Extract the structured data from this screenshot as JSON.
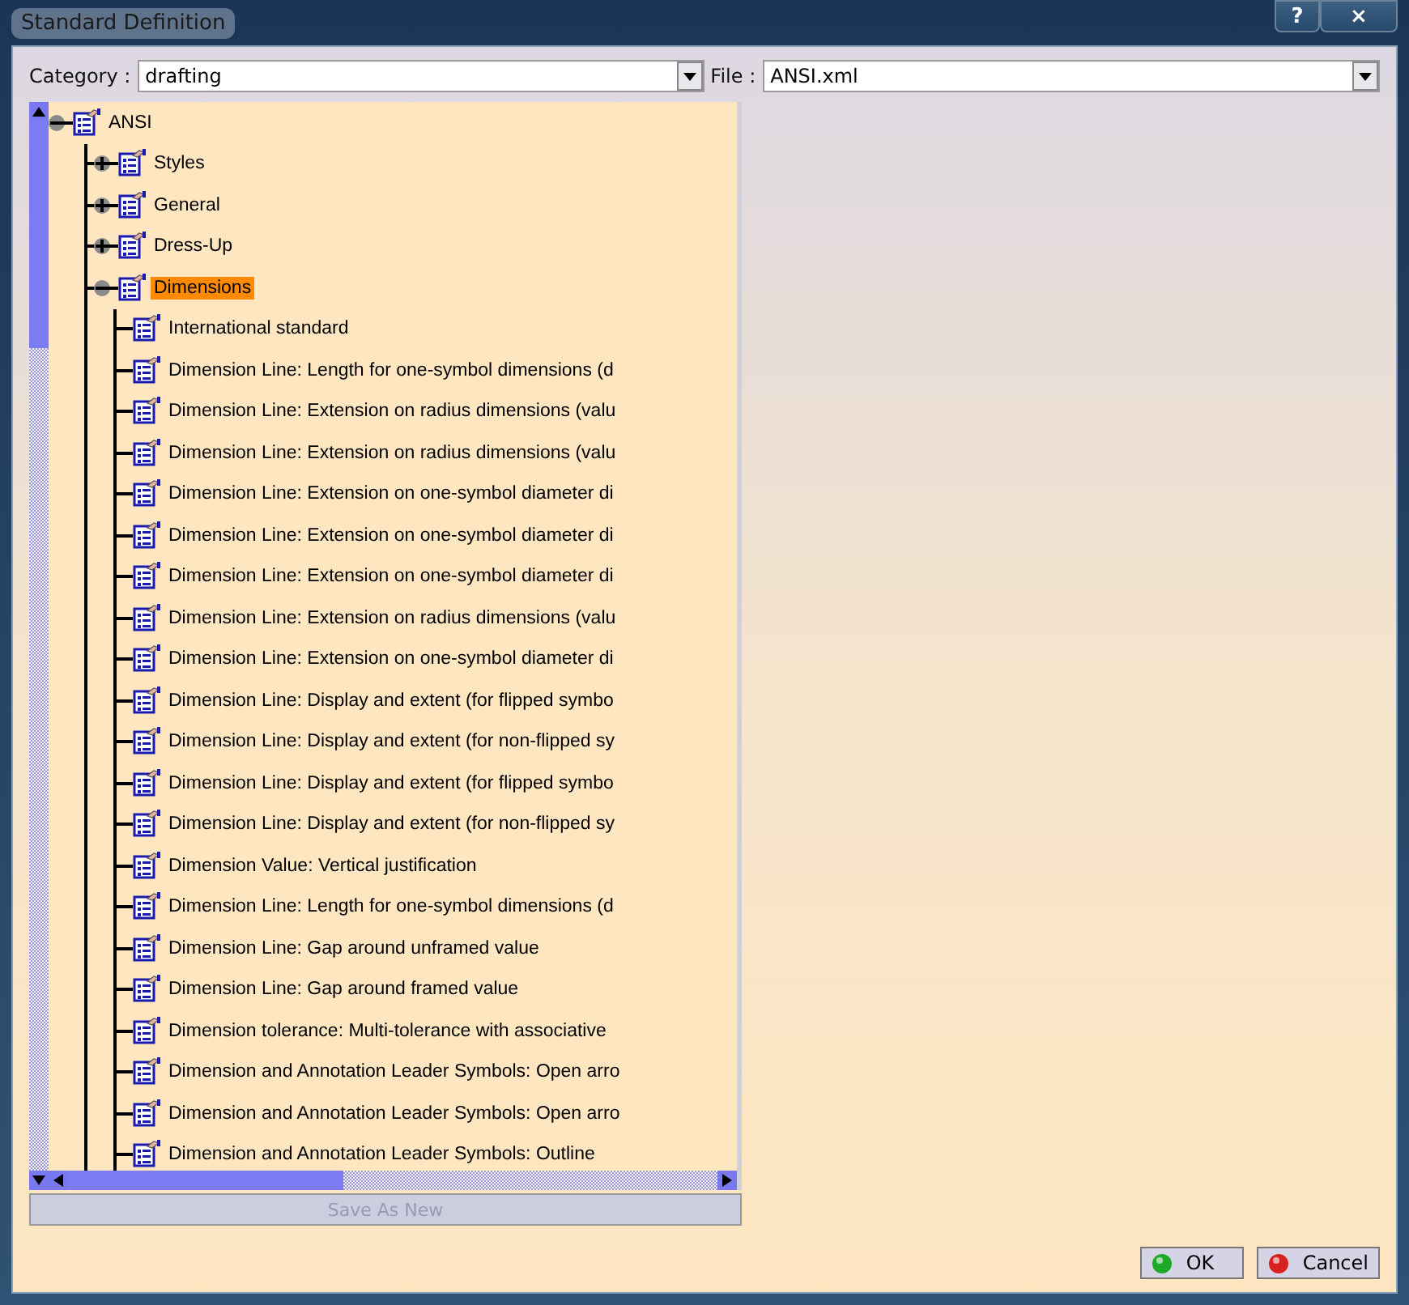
{
  "window": {
    "title": "Standard Definition",
    "buttons": [
      "?",
      "×"
    ]
  },
  "category": {
    "label": "Category :",
    "value": "drafting"
  },
  "file": {
    "label": "File :",
    "value": "ANSI.xml"
  },
  "tree": [
    {
      "label": "ANSI",
      "expanded": true,
      "selected": false,
      "children": [
        {
          "label": "Styles",
          "expanded": false,
          "selected": false
        },
        {
          "label": "General",
          "expanded": false,
          "selected": false
        },
        {
          "label": "Dress-Up",
          "expanded": false,
          "selected": false
        },
        {
          "label": "Dimensions",
          "expanded": true,
          "selected": true,
          "children": [
            {
              "label": "International standard",
              "selected": false
            },
            {
              "label": "Dimension Line: Length for one-symbol dimensions (d",
              "selected": false
            },
            {
              "label": "Dimension Line: Extension on radius dimensions (valu",
              "selected": false
            },
            {
              "label": "Dimension Line: Extension on radius dimensions (valu",
              "selected": false
            },
            {
              "label": "Dimension Line: Extension on one-symbol diameter di",
              "selected": false
            },
            {
              "label": "Dimension Line: Extension on one-symbol diameter di",
              "selected": false
            },
            {
              "label": "Dimension Line: Extension on one-symbol diameter di",
              "selected": false
            },
            {
              "label": "Dimension Line: Extension on radius dimensions (valu",
              "selected": false
            },
            {
              "label": "Dimension Line: Extension on one-symbol diameter di",
              "selected": false
            },
            {
              "label": "Dimension Line: Display and extent (for flipped symbo",
              "selected": false
            },
            {
              "label": "Dimension Line: Display and extent (for non-flipped sy",
              "selected": false
            },
            {
              "label": "Dimension Line: Display and extent (for flipped symbo",
              "selected": false
            },
            {
              "label": "Dimension Line: Display and extent (for non-flipped sy",
              "selected": false
            },
            {
              "label": "Dimension Value: Vertical justification",
              "selected": false
            },
            {
              "label": "Dimension Line: Length for one-symbol dimensions (d",
              "selected": false
            },
            {
              "label": "Dimension Line: Gap around unframed value",
              "selected": false
            },
            {
              "label": "Dimension Line: Gap around framed value",
              "selected": false
            },
            {
              "label": "Dimension tolerance: Multi-tolerance with associative",
              "selected": false
            },
            {
              "label": "Dimension and Annotation Leader Symbols: Open arro",
              "selected": false
            },
            {
              "label": "Dimension and Annotation Leader Symbols: Open arro",
              "selected": false
            },
            {
              "label": "Dimension and Annotation Leader Symbols: Outline",
              "selected": false
            }
          ]
        }
      ]
    }
  ],
  "save_as_new": {
    "label": "Save As New",
    "disabled": true
  },
  "buttons": [
    {
      "label": "OK",
      "kind": "ok"
    },
    {
      "label": "Cancel",
      "kind": "cancel"
    }
  ]
}
